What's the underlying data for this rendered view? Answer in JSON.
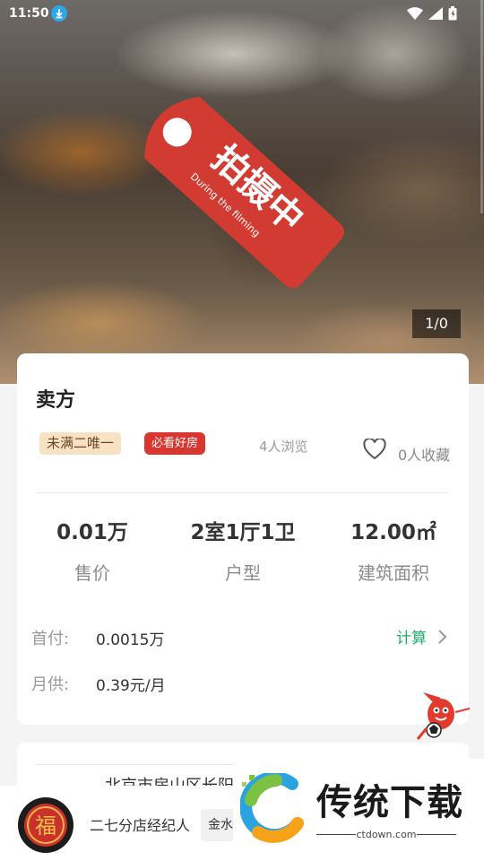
{
  "status_bar": {
    "time": "11:50"
  },
  "hero": {
    "tag_main": "拍摄中",
    "tag_sub": "During the filming",
    "photo_counter": "1/0"
  },
  "card": {
    "title": "卖方",
    "tags": [
      "未满二唯一",
      "必看好房"
    ],
    "views": "4人浏览",
    "favorites": "0人收藏",
    "stats": [
      {
        "value": "0.01万",
        "label": "售价"
      },
      {
        "value": "2室1厅1卫",
        "label": "户型"
      },
      {
        "value": "12.00㎡",
        "label": "建筑面积"
      }
    ],
    "down_payment": {
      "label": "首付:",
      "value": "0.0015万"
    },
    "monthly": {
      "label": "月供:",
      "value": "0.39元/月"
    },
    "calc_label": "计算"
  },
  "card2": {
    "address": "北京市房山区长阳"
  },
  "footer": {
    "agent": "二七分店经纪人",
    "badge": "金水",
    "avatar_glyph": "福"
  },
  "watermark": {
    "title": "传统下载",
    "url": "ctdown.com"
  },
  "colors": {
    "tag_red": "#d8362e",
    "calc_green": "#18b26a",
    "tag_beige": "#f8e2c4"
  }
}
